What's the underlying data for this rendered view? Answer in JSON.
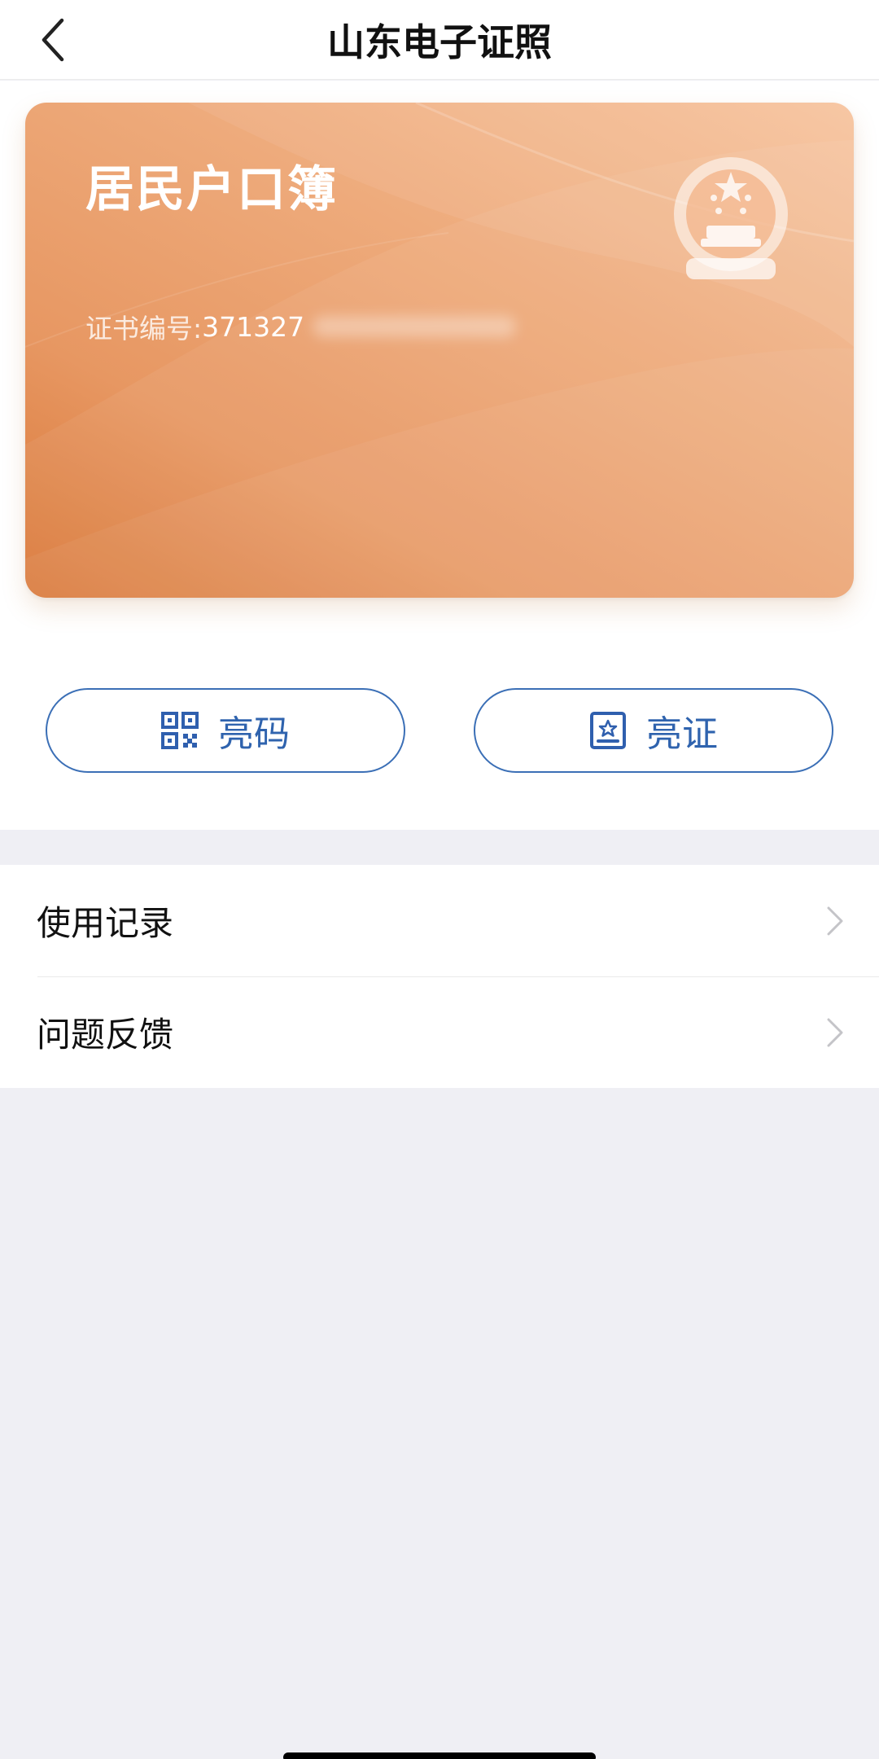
{
  "header": {
    "title": "山东电子证照",
    "back_icon": "chevron-left-icon"
  },
  "card": {
    "title": "居民户口簿",
    "cert_label": "证书编号:",
    "cert_number_visible": "371327",
    "emblem_icon": "national-emblem-icon",
    "colors": {
      "gradient_start": "#F7C39D",
      "gradient_end": "#D97737"
    }
  },
  "actions": {
    "show_code": {
      "label": "亮码",
      "icon": "qr-code-icon"
    },
    "show_cert": {
      "label": "亮证",
      "icon": "certificate-icon"
    },
    "accent_color": "#3B6FB6"
  },
  "list": {
    "items": [
      {
        "label": "使用记录",
        "icon": "chevron-right-icon"
      },
      {
        "label": "问题反馈",
        "icon": "chevron-right-icon"
      }
    ]
  }
}
